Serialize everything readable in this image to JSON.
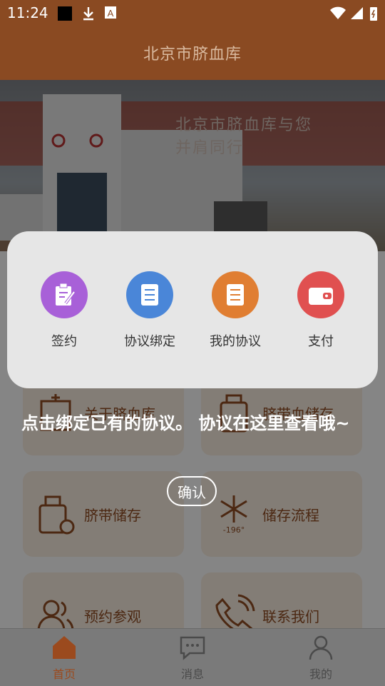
{
  "status_bar": {
    "time": "11:24"
  },
  "header": {
    "title": "北京市脐血库"
  },
  "banner": {
    "slogan_line1": "北京市脐血库与您",
    "slogan_line2": "并肩同行",
    "active_dot": 1,
    "dot_count": 4
  },
  "actions": [
    {
      "label": "签约",
      "icon": "clipboard-pen-icon",
      "color": "#a860d8"
    },
    {
      "label": "协议绑定",
      "icon": "document-icon",
      "color": "#4a86d8"
    },
    {
      "label": "我的协议",
      "icon": "document-icon",
      "color": "#e07e32"
    },
    {
      "label": "支付",
      "icon": "wallet-icon",
      "color": "#e05050"
    }
  ],
  "tiles": [
    {
      "label": "关于脐血库",
      "icon": "building-icon"
    },
    {
      "label": "脐带血储存",
      "icon": "storage-tank-icon"
    },
    {
      "label": "脐带储存",
      "icon": "storage-tank-icon"
    },
    {
      "label": "储存流程",
      "icon": "snowflake-icon",
      "sub": "-196°"
    },
    {
      "label": "预约参观",
      "icon": "people-icon"
    },
    {
      "label": "联系我们",
      "icon": "phone-icon"
    }
  ],
  "guide": {
    "text": "点击绑定已有的协议。 协议在这里查看哦~",
    "confirm_label": "确认"
  },
  "tabbar": [
    {
      "label": "首页",
      "icon": "home-icon",
      "active": true
    },
    {
      "label": "消息",
      "icon": "message-icon",
      "active": false
    },
    {
      "label": "我的",
      "icon": "user-icon",
      "active": false
    }
  ]
}
